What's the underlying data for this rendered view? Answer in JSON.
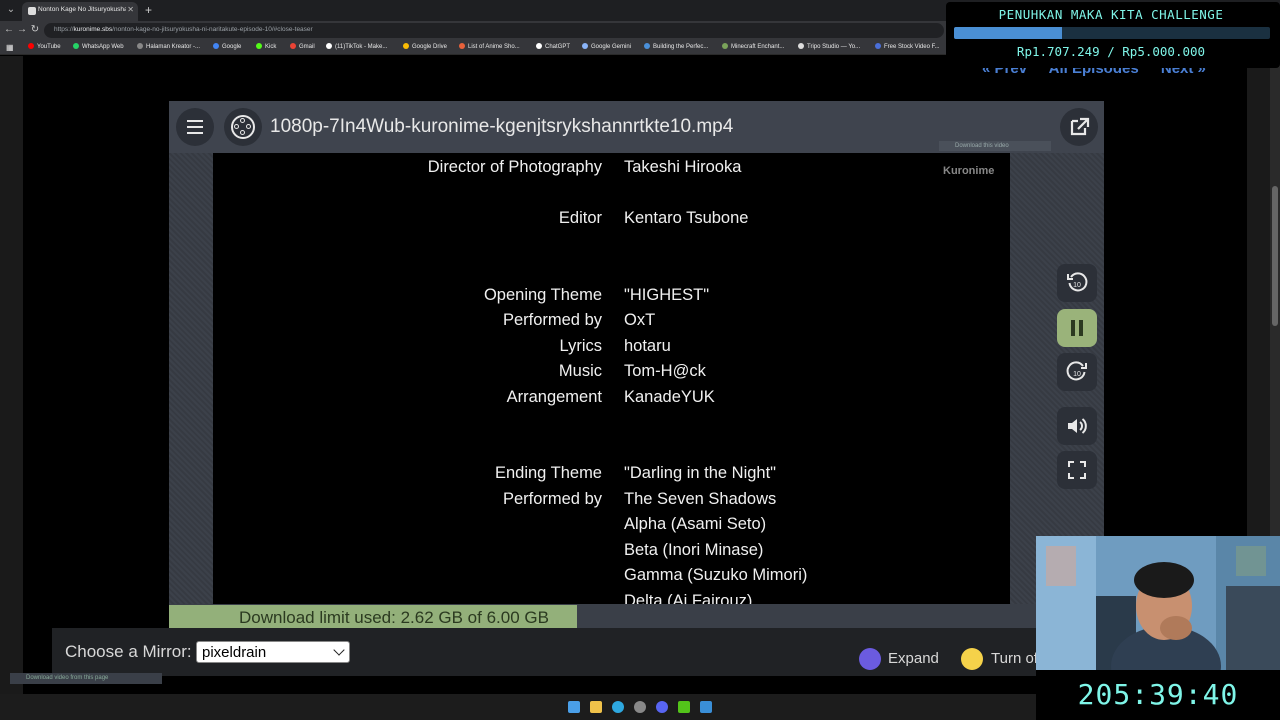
{
  "browser": {
    "tab_title": "Nonton Kage No Jitsuryokusha Ni...",
    "url_host": "kuronime.sbs",
    "url_prefix": "https://",
    "url_path": "/nonton-kage-no-jitsuryokusha-ni-naritakute-episode-10/#close-teaser",
    "bookmarks": [
      {
        "label": "YouTube",
        "color": "#ff0000"
      },
      {
        "label": "WhatsApp Web",
        "color": "#25d366"
      },
      {
        "label": "Halaman Kreator -...",
        "color": "#888888"
      },
      {
        "label": "Google",
        "color": "#4285f4"
      },
      {
        "label": "Kick",
        "color": "#53fc18"
      },
      {
        "label": "Gmail",
        "color": "#ea4335"
      },
      {
        "label": "(11)TikTok - Make...",
        "color": "#ffffff"
      },
      {
        "label": "Google Drive",
        "color": "#fbbc04"
      },
      {
        "label": "List of Anime Sho...",
        "color": "#e8613a"
      },
      {
        "label": "ChatGPT",
        "color": "#ffffff"
      },
      {
        "label": "Google Gemini",
        "color": "#8ab4f8"
      },
      {
        "label": "Building the Perfec...",
        "color": "#4a90d9"
      },
      {
        "label": "Minecraft Enchant...",
        "color": "#7aa35a"
      },
      {
        "label": "Tripo Studio — Yo...",
        "color": "#dddddd"
      },
      {
        "label": "Free Stock Video F...",
        "color": "#4a6fd9"
      }
    ]
  },
  "episode_nav": {
    "prev": "« Prev",
    "all": "All Episodes",
    "next": "Next »"
  },
  "player": {
    "file_title": "1080p-7In4Wub-kuronime-kgenjtsrykshannrtkte10.mp4",
    "watermark": "Kuronime",
    "mini_download": "Download this video",
    "credits": [
      {
        "role": "Director of Photography",
        "name": "Takeshi Hirooka"
      },
      {
        "role": "Editor",
        "name": "Kentaro Tsubone"
      },
      {
        "role": "Opening Theme",
        "name": "\"HIGHEST\""
      },
      {
        "role": "Performed by",
        "name": "OxT"
      },
      {
        "role": "Lyrics",
        "name": "hotaru"
      },
      {
        "role": "Music",
        "name": "Tom-H@ck"
      },
      {
        "role": "Arrangement",
        "name": "KanadeYUK"
      },
      {
        "role": "Ending Theme",
        "name": "\"Darling in the Night\""
      },
      {
        "role": "Performed by",
        "name": "The Seven Shadows"
      },
      {
        "role": "",
        "name": "Alpha (Asami Seto)"
      },
      {
        "role": "",
        "name": "Beta (Inori Minase)"
      },
      {
        "role": "",
        "name": "Gamma (Suzuko Mimori)"
      },
      {
        "role": "",
        "name": "Delta (Ai Fairouz)"
      }
    ],
    "controls": [
      "rewind-10",
      "pause",
      "forward-10",
      "volume",
      "fullscreen"
    ],
    "download_limit": "Download limit used: 2.62 GB of 6.00 GB",
    "download_used_gb": 2.62,
    "download_total_gb": 6.0
  },
  "mirror": {
    "label": "Choose a Mirror:",
    "selected": "pixeldrain",
    "expand_label": "Expand",
    "turnoff_label": "Turn off Light",
    "download_from_page": "Download video from this page"
  },
  "challenge": {
    "title": "PENUHKAN MAKA KITA CHALLENGE",
    "amount": "Rp1.707.249 / Rp5.000.000",
    "progress": 0.341
  },
  "timer": "205:39:40",
  "colors": {
    "accent_cyan": "#7ff5e8",
    "limit_bar": "#93b07a",
    "pause_active": "#9ab37a",
    "nav_link": "#4a7fd4"
  }
}
